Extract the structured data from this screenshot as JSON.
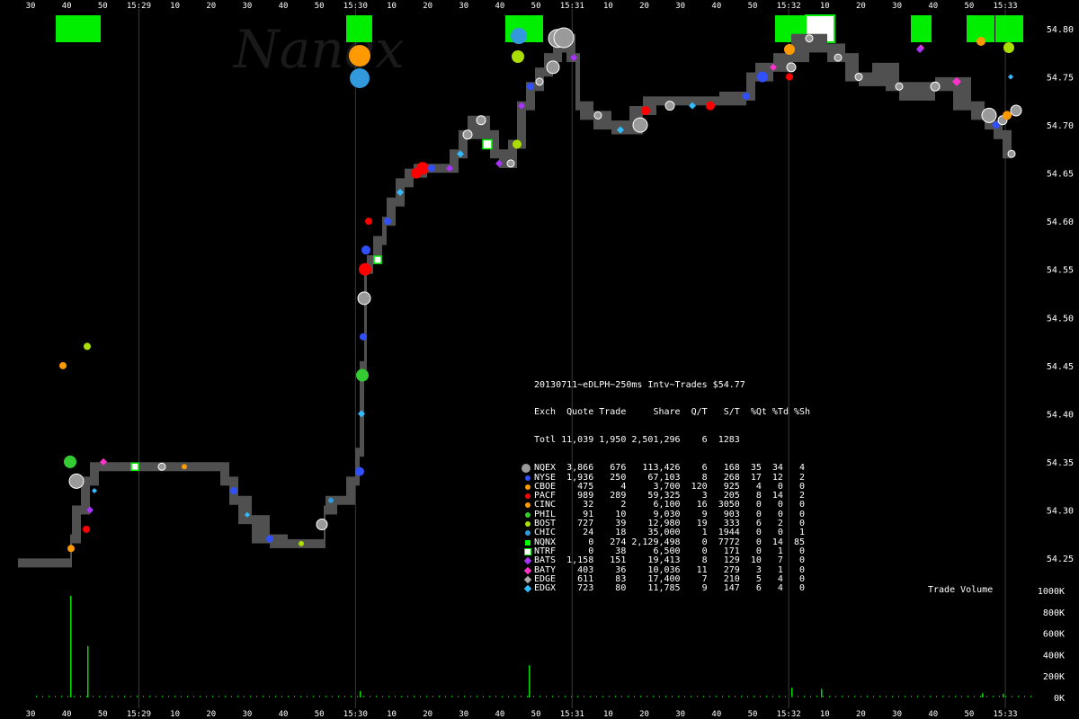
{
  "watermark": "Nanex",
  "chart_data": {
    "type": "scatter",
    "title": "20130711~eDLPH~250ms Intv~Trades $54.77",
    "price_axis": {
      "ticks": [
        "54.80",
        "54.75",
        "54.70",
        "54.65",
        "54.60",
        "54.55",
        "54.50",
        "54.45",
        "54.40",
        "54.35",
        "54.30",
        "54.25"
      ],
      "ylim": [
        54.22,
        54.82
      ]
    },
    "volume_axis": {
      "label": "Trade Volume",
      "ticks": [
        "1000K",
        "800K",
        "600K",
        "400K",
        "200K",
        "0K"
      ],
      "ylim": [
        0,
        1000
      ]
    },
    "time_axis": {
      "ticks": [
        "30",
        "40",
        "50",
        "15:29",
        "10",
        "20",
        "30",
        "40",
        "50",
        "15:30",
        "10",
        "20",
        "30",
        "40",
        "50",
        "15:31",
        "10",
        "20",
        "30",
        "40",
        "50",
        "15:32",
        "10",
        "20",
        "30",
        "40",
        "50",
        "15:33"
      ],
      "major": [
        "15:29",
        "15:30",
        "15:31",
        "15:32",
        "15:33"
      ]
    },
    "price_path": [
      [
        20,
        54.245
      ],
      [
        78,
        54.245
      ],
      [
        80,
        54.27
      ],
      [
        90,
        54.3
      ],
      [
        100,
        54.33
      ],
      [
        110,
        54.345
      ],
      [
        125,
        54.345
      ],
      [
        150,
        54.345
      ],
      [
        180,
        54.345
      ],
      [
        245,
        54.345
      ],
      [
        255,
        54.33
      ],
      [
        265,
        54.31
      ],
      [
        280,
        54.29
      ],
      [
        300,
        54.27
      ],
      [
        320,
        54.265
      ],
      [
        360,
        54.265
      ],
      [
        362,
        54.3
      ],
      [
        375,
        54.31
      ],
      [
        385,
        54.31
      ],
      [
        395,
        54.33
      ],
      [
        400,
        54.36
      ],
      [
        405,
        54.45
      ],
      [
        408,
        54.55
      ],
      [
        415,
        54.56
      ],
      [
        425,
        54.58
      ],
      [
        430,
        54.6
      ],
      [
        440,
        54.62
      ],
      [
        450,
        54.64
      ],
      [
        460,
        54.65
      ],
      [
        475,
        54.655
      ],
      [
        500,
        54.655
      ],
      [
        510,
        54.67
      ],
      [
        520,
        54.69
      ],
      [
        535,
        54.705
      ],
      [
        545,
        54.69
      ],
      [
        555,
        54.67
      ],
      [
        565,
        54.66
      ],
      [
        575,
        54.68
      ],
      [
        585,
        54.72
      ],
      [
        595,
        54.74
      ],
      [
        605,
        54.755
      ],
      [
        615,
        54.77
      ],
      [
        625,
        54.78
      ],
      [
        630,
        54.79
      ],
      [
        640,
        54.77
      ],
      [
        645,
        54.72
      ],
      [
        660,
        54.71
      ],
      [
        680,
        54.7
      ],
      [
        700,
        54.695
      ],
      [
        715,
        54.715
      ],
      [
        730,
        54.725
      ],
      [
        760,
        54.725
      ],
      [
        800,
        54.725
      ],
      [
        830,
        54.73
      ],
      [
        840,
        54.75
      ],
      [
        860,
        54.76
      ],
      [
        880,
        54.77
      ],
      [
        900,
        54.79
      ],
      [
        920,
        54.78
      ],
      [
        940,
        54.77
      ],
      [
        955,
        54.75
      ],
      [
        970,
        54.745
      ],
      [
        985,
        54.76
      ],
      [
        1000,
        54.74
      ],
      [
        1020,
        54.73
      ],
      [
        1040,
        54.74
      ],
      [
        1060,
        54.745
      ],
      [
        1080,
        54.72
      ],
      [
        1095,
        54.71
      ],
      [
        1105,
        54.7
      ],
      [
        1115,
        54.69
      ],
      [
        1125,
        54.67
      ]
    ],
    "trades": [
      [
        79,
        54.26,
        "CBOE",
        4
      ],
      [
        85,
        54.33,
        "NQEX",
        8
      ],
      [
        96,
        54.28,
        "PACF",
        4
      ],
      [
        100,
        54.3,
        "BATS",
        4
      ],
      [
        105,
        54.32,
        "EDGX",
        3
      ],
      [
        115,
        54.35,
        "BATY",
        4
      ],
      [
        78,
        54.35,
        "PHIL",
        7
      ],
      [
        70,
        54.45,
        "CINC",
        4
      ],
      [
        97,
        54.47,
        "BOST",
        4
      ],
      [
        150,
        54.345,
        "NTRF",
        4
      ],
      [
        180,
        54.345,
        "NQEX",
        4
      ],
      [
        205,
        54.345,
        "CINC",
        3
      ],
      [
        260,
        54.32,
        "NYSE",
        4
      ],
      [
        275,
        54.295,
        "EDGX",
        3
      ],
      [
        300,
        54.27,
        "NYSE",
        4
      ],
      [
        335,
        54.265,
        "BOST",
        3
      ],
      [
        358,
        54.285,
        "NQEX",
        6
      ],
      [
        368,
        54.31,
        "CHIC",
        3
      ],
      [
        400,
        54.34,
        "NYSE",
        5
      ],
      [
        402,
        54.4,
        "EDGX",
        4
      ],
      [
        403,
        54.44,
        "PHIL",
        7
      ],
      [
        404,
        54.48,
        "NYSE",
        4
      ],
      [
        405,
        54.52,
        "NQEX",
        7
      ],
      [
        406,
        54.55,
        "PACF",
        7
      ],
      [
        407,
        54.57,
        "NYSE",
        5
      ],
      [
        410,
        54.6,
        "PACF",
        4
      ],
      [
        420,
        54.56,
        "NTRF",
        4
      ],
      [
        431,
        54.6,
        "NYSE",
        4
      ],
      [
        445,
        54.63,
        "EDGX",
        4
      ],
      [
        463,
        54.65,
        "PACF",
        6
      ],
      [
        470,
        54.655,
        "PACF",
        7
      ],
      [
        480,
        54.655,
        "NYSE",
        4
      ],
      [
        500,
        54.655,
        "BATS",
        4
      ],
      [
        512,
        54.67,
        "EDGX",
        4
      ],
      [
        520,
        54.69,
        "NQEX",
        5
      ],
      [
        535,
        54.705,
        "NQEX",
        5
      ],
      [
        542,
        54.68,
        "NTRF",
        5
      ],
      [
        555,
        54.66,
        "BATS",
        4
      ],
      [
        568,
        54.66,
        "NQEX",
        4
      ],
      [
        575,
        54.68,
        "BOST",
        5
      ],
      [
        580,
        54.72,
        "BATS",
        4
      ],
      [
        590,
        54.74,
        "NYSE",
        4
      ],
      [
        600,
        54.745,
        "NQEX",
        4
      ],
      [
        615,
        54.76,
        "NQEX",
        7
      ],
      [
        620,
        54.79,
        "NQEX",
        10
      ],
      [
        628,
        54.795,
        "EDGX",
        4
      ],
      [
        638,
        54.77,
        "BATS",
        4
      ],
      [
        665,
        54.71,
        "NQEX",
        4
      ],
      [
        690,
        54.695,
        "EDGX",
        4
      ],
      [
        712,
        54.7,
        "NQEX",
        8
      ],
      [
        718,
        54.715,
        "PACF",
        5
      ],
      [
        745,
        54.72,
        "NQEX",
        5
      ],
      [
        770,
        54.72,
        "EDGX",
        4
      ],
      [
        790,
        54.72,
        "PACF",
        5
      ],
      [
        830,
        54.73,
        "NYSE",
        4
      ],
      [
        848,
        54.75,
        "NYSE",
        6
      ],
      [
        860,
        54.76,
        "BATY",
        4
      ],
      [
        878,
        54.75,
        "PACF",
        4
      ],
      [
        878,
        54.78,
        "BATY",
        4
      ],
      [
        880,
        54.76,
        "NQEX",
        5
      ],
      [
        900,
        54.79,
        "NQEX",
        4
      ],
      [
        932,
        54.77,
        "NQEX",
        4
      ],
      [
        955,
        54.75,
        "NQEX",
        4
      ],
      [
        1000,
        54.74,
        "NQEX",
        4
      ],
      [
        1024,
        54.78,
        "BATY",
        4
      ],
      [
        1040,
        54.74,
        "NQEX",
        5
      ],
      [
        1064,
        54.745,
        "BATY",
        5
      ],
      [
        1100,
        54.71,
        "NQEX",
        8
      ],
      [
        1108,
        54.7,
        "NYSE",
        4
      ],
      [
        1115,
        54.705,
        "NQEX",
        5
      ],
      [
        1120,
        54.71,
        "CINC",
        5
      ],
      [
        1124,
        54.75,
        "EDGX",
        3
      ],
      [
        1130,
        54.715,
        "NQEX",
        6
      ],
      [
        1125,
        54.67,
        "NQEX",
        4
      ]
    ],
    "volume_bars": [
      [
        78,
        950
      ],
      [
        97,
        480
      ],
      [
        400,
        60
      ],
      [
        588,
        300
      ],
      [
        880,
        90
      ],
      [
        913,
        80
      ],
      [
        1092,
        40
      ],
      [
        1115,
        35
      ]
    ],
    "top_blocks": [
      [
        62,
        112
      ],
      [
        385,
        414
      ],
      [
        562,
        604
      ],
      [
        862,
        896
      ],
      [
        896,
        928
      ],
      [
        1013,
        1036
      ],
      [
        1075,
        1106
      ],
      [
        1107,
        1138
      ]
    ],
    "top_markers": [
      [
        400,
        62,
        "CINC",
        12
      ],
      [
        400,
        87,
        "CHIC",
        11
      ],
      [
        577,
        40,
        "CHIC",
        9
      ],
      [
        576,
        63,
        "BOST",
        7
      ],
      [
        627,
        42,
        "NQEX",
        11
      ],
      [
        878,
        55,
        "CINC",
        6
      ],
      [
        1023,
        55,
        "BATS",
        4
      ],
      [
        1091,
        46,
        "CINC",
        5
      ],
      [
        1122,
        53,
        "BOST",
        6
      ]
    ],
    "table": {
      "header_line": "Exch  Quote Trade     Share  Q/T   S/T  %Qt %Td %Sh",
      "total_line": "Totl 11,039 1,950 2,501,296    6  1283",
      "rows": [
        {
          "exch": "NQEX",
          "color": "#9a9a9a",
          "shape": "circle-lg",
          "line": "NQEX  3,866   676   113,426    6   168  35  34   4"
        },
        {
          "exch": "NYSE",
          "color": "#3050ff",
          "shape": "circle",
          "line": "NYSE  1,936   250    67,103    8   268  17  12   2"
        },
        {
          "exch": "CBOE",
          "color": "#ff9900",
          "shape": "dot",
          "line": "CBOE    475     4     3,700  120   925   4   0   0"
        },
        {
          "exch": "PACF",
          "color": "#ff0000",
          "shape": "dot",
          "line": "PACF    989   289    59,325    3   205   8  14   2"
        },
        {
          "exch": "CINC",
          "color": "#ff9900",
          "shape": "dot",
          "line": "CINC     32     2     6,100   16  3050   0   0   0"
        },
        {
          "exch": "PHIL",
          "color": "#33cc33",
          "shape": "dot",
          "line": "PHIL     91    10     9,030    9   903   0   0   0"
        },
        {
          "exch": "BOST",
          "color": "#aadd00",
          "shape": "dot",
          "line": "BOST    727    39    12,980   19   333   6   2   0"
        },
        {
          "exch": "CHIC",
          "color": "#3399dd",
          "shape": "dot",
          "line": "CHIC     24    18    35,000    1  1944   0   0   1"
        },
        {
          "exch": "NQNX",
          "color": "#00ff00",
          "shape": "square",
          "line": "NQNX      0   274 2,129,498    0  7772   0  14  85"
        },
        {
          "exch": "NTRF",
          "color": "#ffffff",
          "shape": "square-outline",
          "line": "NTRF      0    38     6,500    0   171   0   1   0"
        },
        {
          "exch": "BATS",
          "color": "#aa33ff",
          "shape": "diamond",
          "line": "BATS  1,158   151    19,413    8   129  10   7   0"
        },
        {
          "exch": "BATY",
          "color": "#ff33cc",
          "shape": "diamond",
          "line": "BATY    403    36    10,036   11   279   3   1   0"
        },
        {
          "exch": "EDGE",
          "color": "#aaaaaa",
          "shape": "diamond",
          "line": "EDGE    611    83    17,400    7   210   5   4   0"
        },
        {
          "exch": "EDGX",
          "color": "#33bbff",
          "shape": "diamond",
          "line": "EDGX    723    80    11,785    9   147   6   4   0"
        }
      ]
    }
  }
}
